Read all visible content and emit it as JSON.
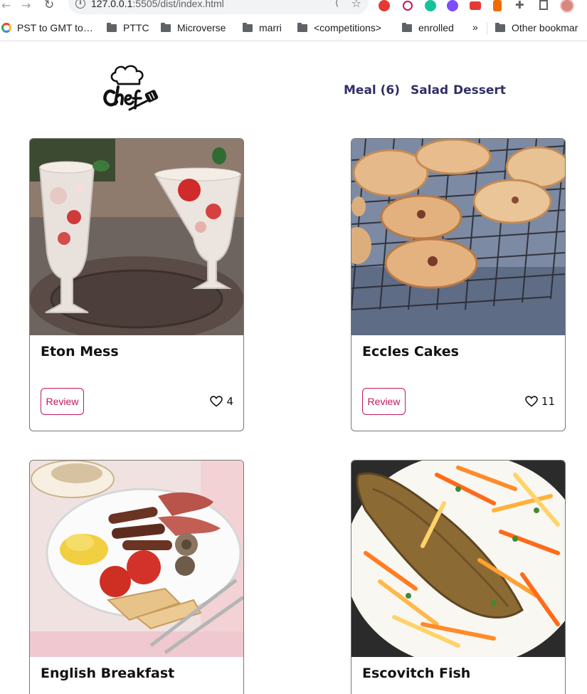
{
  "browser": {
    "url_host": "127.0.0.1",
    "url_rest": ":5505/dist/index.html",
    "bookmarks": [
      "PST to GMT to…",
      "PTTC",
      "Microverse",
      "marri",
      "<competitions>",
      "enrolled"
    ],
    "bookmarks_more": "»",
    "other_bookmarks": "Other bookmar"
  },
  "nav": {
    "meal": "Meal (6)",
    "salad": "Salad",
    "dessert": "Dessert"
  },
  "colors": {
    "accent": "#c2185b",
    "nav_text": "#312f66"
  },
  "cards": [
    {
      "title": "Eton Mess",
      "review": "Review",
      "likes": "4"
    },
    {
      "title": "Eccles Cakes",
      "review": "Review",
      "likes": "11"
    },
    {
      "title": "English Breakfast"
    },
    {
      "title": "Escovitch Fish"
    }
  ]
}
